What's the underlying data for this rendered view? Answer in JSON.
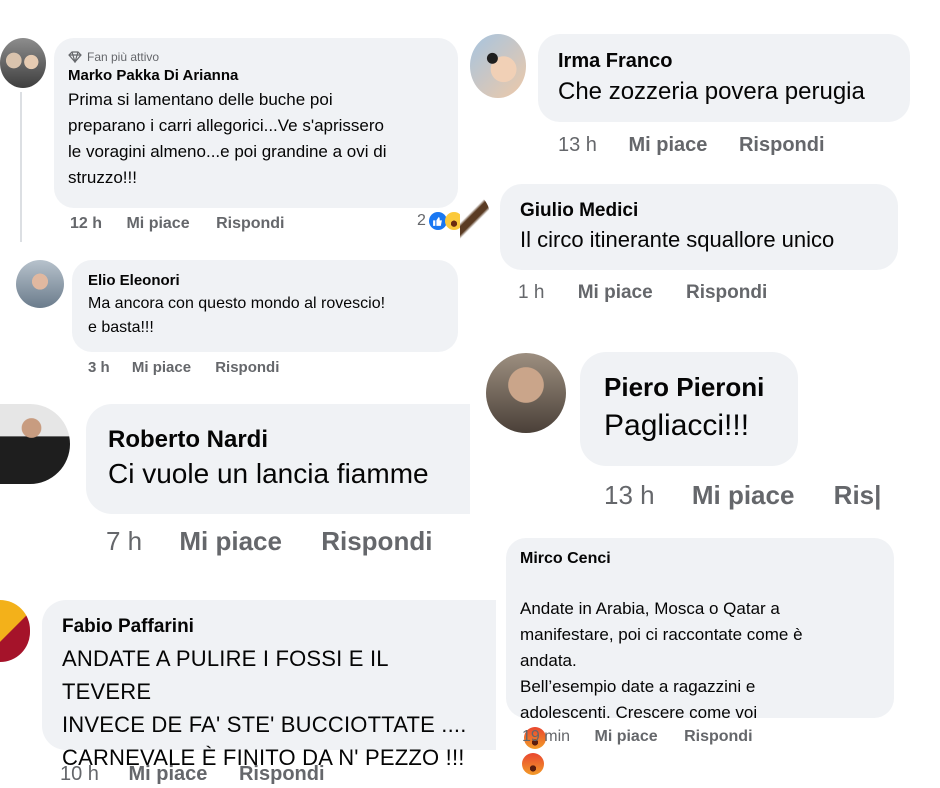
{
  "comments": [
    {
      "badge": "Fan più attivo",
      "name": "Marko Pakka Di Arianna",
      "text": "Prima si lamentano delle buche poi\npreparano i carri allegorici...Ve s'aprissero\nle voragini almeno...e poi grandine a ovi di\nstruzzo!!!",
      "time": "12 h",
      "like": "Mi piace",
      "reply": "Rispondi",
      "reaction_count": "2",
      "reaction_icons": [
        "like-icon",
        "laughing-emoji-icon"
      ]
    },
    {
      "name": "Irma Franco",
      "text": "Che zozzeria  povera perugia",
      "time": "13 h",
      "like": "Mi piace",
      "reply": "Rispondi"
    },
    {
      "name": "Giulio Medici",
      "text": "Il circo itinerante squallore unico",
      "time": "1 h",
      "like": "Mi piace",
      "reply": "Rispondi"
    },
    {
      "name": "Elio Eleonori",
      "text": "Ma ancora con questo mondo al rovescio!\ne basta!!!",
      "time": "3 h",
      "like": "Mi piace",
      "reply": "Rispondi"
    },
    {
      "name": "Piero Pieroni",
      "text": "Pagliacci!!!",
      "time": "13 h",
      "like": "Mi piace",
      "reply": "Ris|"
    },
    {
      "name": "Roberto Nardi",
      "text": "Ci vuole un lancia fiamme",
      "time": "7 h",
      "like": "Mi piace",
      "reply": "Rispondi"
    },
    {
      "name": "Mirco Cenci",
      "text": "Andate in Arabia, Mosca o Qatar a\nmanifestare, poi ci raccontate come è\nandata.\nBell’esempio date a ragazzini e\nadolescenti. Crescere come voi",
      "time": "19 min",
      "like": "Mi piace",
      "reply": "Rispondi",
      "trailing_icons": [
        "angry-emoji-icon",
        "angry-emoji-icon"
      ]
    },
    {
      "name": "Fabio Paffarini",
      "text": "ANDATE A PULIRE I FOSSI E IL TEVERE\nINVECE DE FA' STE' BUCCIOTTATE ....\nCARNEVALE È FINITO DA N' PEZZO !!!",
      "time": "10 h",
      "like": "Mi piace",
      "reply": "Rispondi"
    }
  ],
  "colors": {
    "bubble": "#f0f2f5",
    "meta_text": "#65676b",
    "like_blue": "#1877f2",
    "angry_red": "#e9710f"
  }
}
